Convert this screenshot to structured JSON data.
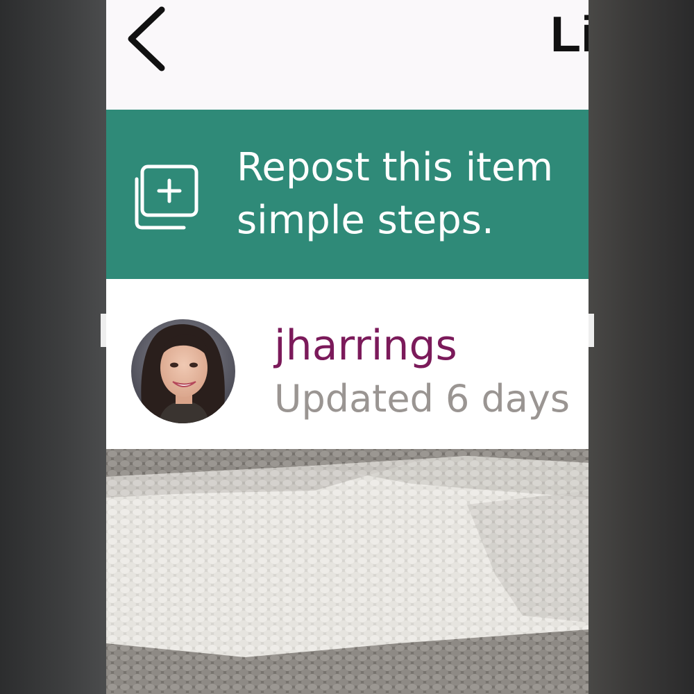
{
  "header": {
    "back_icon": "chevron-left-icon",
    "title_partial": "Li"
  },
  "repost_banner": {
    "icon": "repost-add-icon",
    "line1": "Repost this item",
    "line2": "simple steps.",
    "background": "#2f8a78"
  },
  "seller": {
    "username": "jharrings",
    "updated": "Updated 6 days",
    "username_color": "#7b1a5a",
    "updated_color": "#9a9592"
  },
  "listing": {
    "photo": "knit-textile-photo"
  }
}
